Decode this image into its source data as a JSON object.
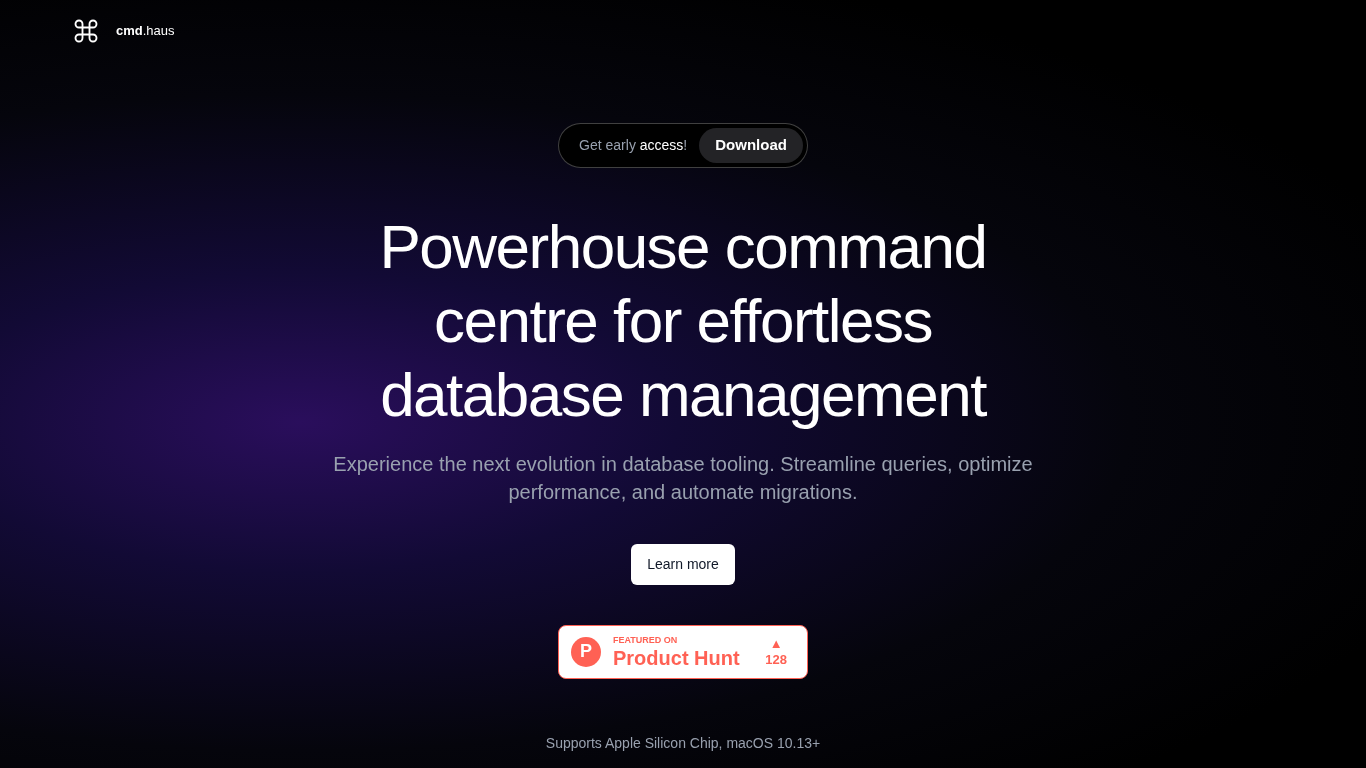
{
  "header": {
    "logo_text": "**cmd**.haus"
  },
  "announcement": {
    "text": "Get early **access**!",
    "button": "Download"
  },
  "hero": {
    "title": "Powerhouse command centre for effortless database management",
    "subtitle": "Experience the next evolution in database tooling. Streamline queries, optimize performance, and automate migrations.",
    "button": "Learn more"
  },
  "badge": {
    "logo_letter": "P",
    "kicker": "FEATURED ON",
    "name": "Product Hunt",
    "arrow": "▲",
    "count": "128"
  },
  "footer_note": "Supports Apple Silicon Chip, macOS 10.13+"
}
